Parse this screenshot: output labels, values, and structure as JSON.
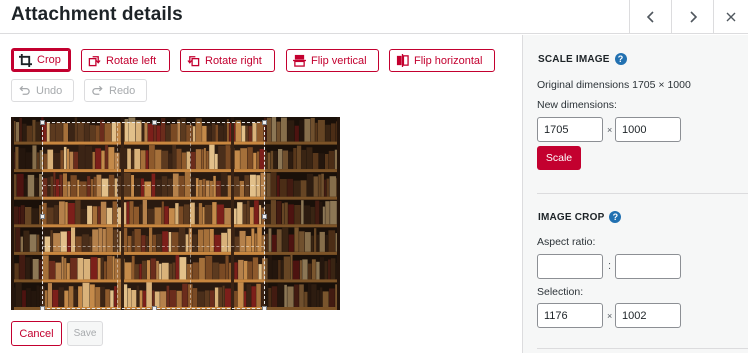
{
  "header": {
    "title": "Attachment details",
    "prev_icon": "chevron-left-icon",
    "next_icon": "chevron-right-icon",
    "close_icon": "close-icon"
  },
  "toolbar": {
    "crop": "Crop",
    "rotate_left": "Rotate left",
    "rotate_right": "Rotate right",
    "flip_vertical": "Flip vertical",
    "flip_horizontal": "Flip horizontal",
    "undo": "Undo",
    "redo": "Redo"
  },
  "image": {
    "description_icon": "bookshelf-photo"
  },
  "actions": {
    "cancel": "Cancel",
    "save": "Save"
  },
  "scale": {
    "title": "SCALE IMAGE",
    "original": "Original dimensions 1705 × 1000",
    "new_dimensions_label": "New dimensions:",
    "width": "1705",
    "height": "1000",
    "times": "×",
    "button": "Scale"
  },
  "crop": {
    "title": "IMAGE CROP",
    "aspect_label": "Aspect ratio:",
    "aspect_w": "",
    "aspect_h": "",
    "colon": ":",
    "selection_label": "Selection:",
    "sel_w": "1176",
    "sel_h": "1002",
    "times": "×"
  },
  "colors": {
    "accent": "#c3002f",
    "help": "#2271b1",
    "sidebar_bg": "#f6f7f7"
  }
}
